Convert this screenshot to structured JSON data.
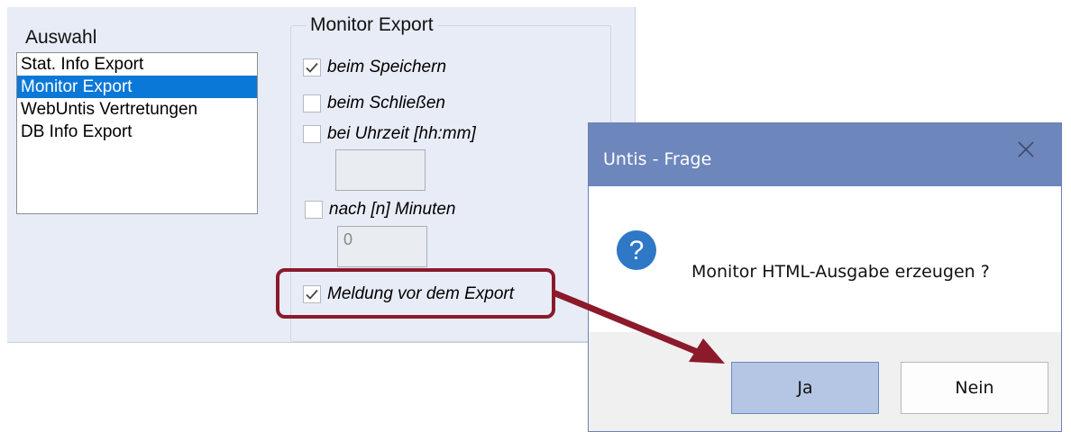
{
  "panel": {
    "auswahl_label": "Auswahl",
    "list_items": [
      "Stat. Info Export",
      "Monitor Export",
      "WebUntis Vertretungen",
      "DB Info Export"
    ],
    "selected_index": 1
  },
  "group": {
    "title": "Monitor Export",
    "options": {
      "beim_speichern": {
        "label": "beim Speichern",
        "checked": true
      },
      "beim_schliessen": {
        "label": "beim Schließen",
        "checked": false
      },
      "bei_uhrzeit": {
        "label": "bei Uhrzeit [hh:mm]",
        "checked": false
      },
      "nach_minuten": {
        "label": "nach [n] Minuten",
        "checked": false
      },
      "meldung": {
        "label": "Meldung vor dem Export",
        "checked": true
      }
    },
    "uhrzeit_value": "",
    "minuten_value": "0"
  },
  "dialog": {
    "title": "Untis - Frage",
    "message": "Monitor HTML-Ausgabe erzeugen ?",
    "yes_label": "Ja",
    "no_label": "Nein",
    "icon": "question-icon"
  },
  "colors": {
    "accent": "#0a78d7",
    "dialog_title_bg": "#6d87bd",
    "highlight": "#8b1a2a"
  }
}
